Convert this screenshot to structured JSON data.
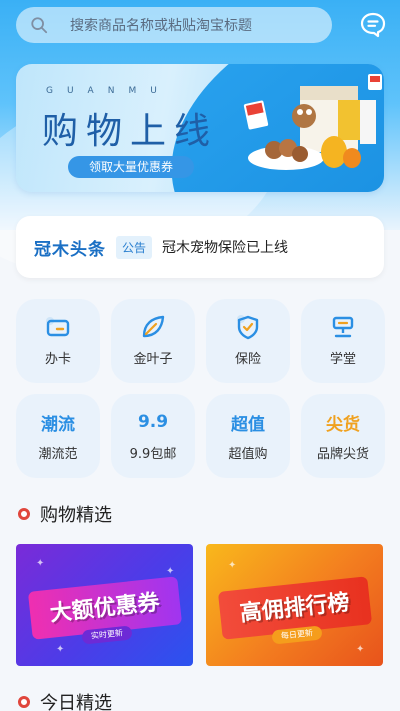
{
  "search": {
    "placeholder": "搜索商品名称或粘贴淘宝标题"
  },
  "colors": {
    "primary": "#2b8fe3",
    "accent": "#f0a11f",
    "section_dot": "#e0463c"
  },
  "banner": {
    "latin": "GUANMU",
    "title": "购物上线",
    "coupon_button": "领取大量优惠券"
  },
  "notice": {
    "brand": "冠木头条",
    "tag": "公告",
    "text": "冠木宠物保险已上线"
  },
  "grid": [
    {
      "label": "办卡",
      "icon": "card-icon"
    },
    {
      "label": "金叶子",
      "icon": "leaf-icon"
    },
    {
      "label": "保险",
      "icon": "shield-icon"
    },
    {
      "label": "学堂",
      "icon": "school-icon"
    },
    {
      "label": "潮流范",
      "icon": "trend-icon",
      "icon_text": "潮流"
    },
    {
      "label": "9.9包邮",
      "icon": "nine-nine-icon",
      "icon_text": "9.9"
    },
    {
      "label": "超值购",
      "icon": "value-icon",
      "icon_text": "超值"
    },
    {
      "label": "品牌尖货",
      "icon": "brand-goods-icon",
      "icon_text": "尖货"
    }
  ],
  "sections": {
    "shopping": "购物精选",
    "today": "今日精选"
  },
  "cards": [
    {
      "headline": "大额优惠券",
      "sub": "实时更新"
    },
    {
      "headline": "高佣排行榜",
      "sub": "每日更新"
    }
  ]
}
